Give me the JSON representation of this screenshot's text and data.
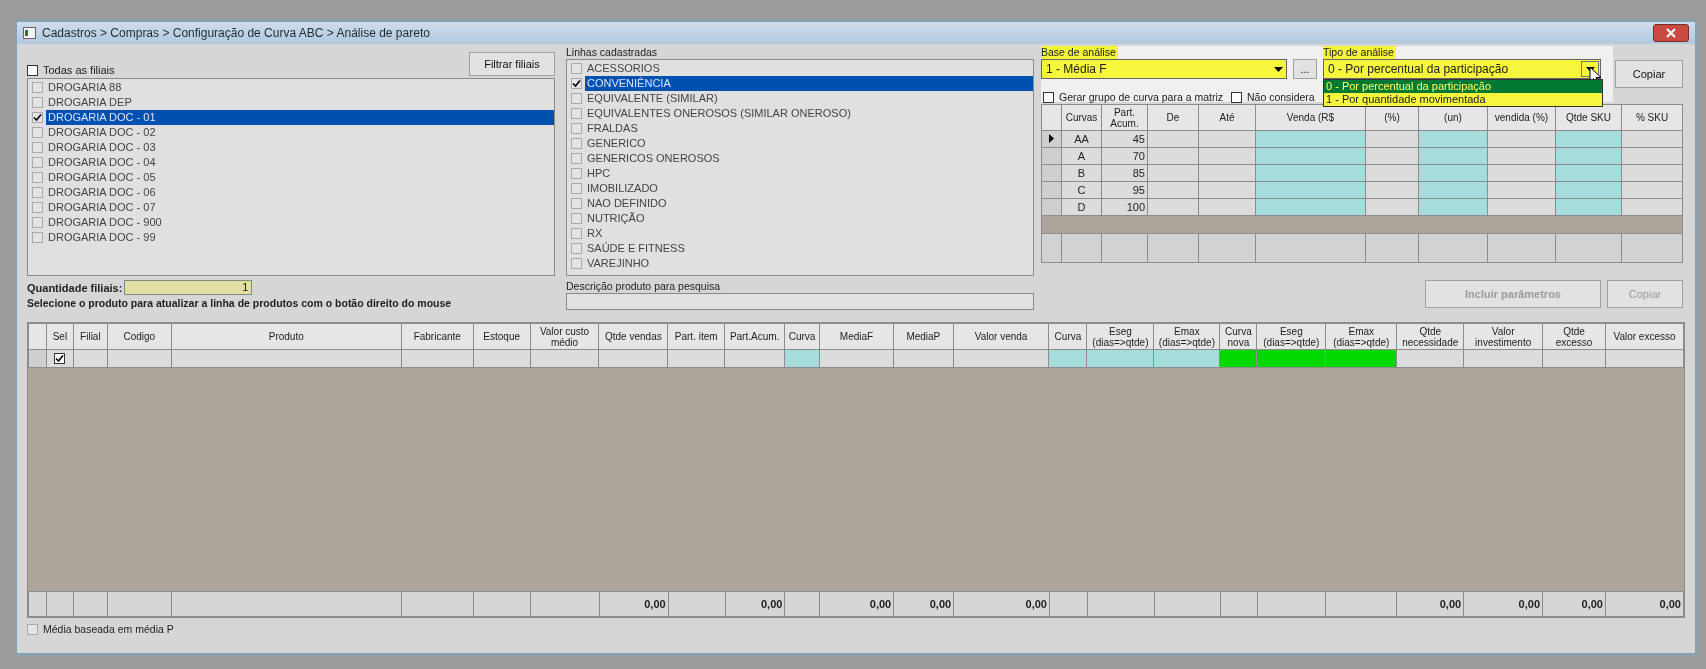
{
  "window": {
    "title": "Cadastros > Compras > Configuração de Curva ABC > Análise de pareto"
  },
  "branches": {
    "all_checkbox": {
      "label": "Todas as filiais",
      "checked": false
    },
    "filter_button": "Filtrar filiais",
    "items": [
      {
        "label": "DROGARIA 88",
        "checked": false,
        "selected": false
      },
      {
        "label": "DROGARIA DEP",
        "checked": false,
        "selected": false
      },
      {
        "label": "DROGARIA DOC - 01",
        "checked": true,
        "selected": true
      },
      {
        "label": "DROGARIA DOC - 02",
        "checked": false,
        "selected": false
      },
      {
        "label": "DROGARIA DOC - 03",
        "checked": false,
        "selected": false
      },
      {
        "label": "DROGARIA DOC - 04",
        "checked": false,
        "selected": false
      },
      {
        "label": "DROGARIA DOC - 05",
        "checked": false,
        "selected": false
      },
      {
        "label": "DROGARIA DOC - 06",
        "checked": false,
        "selected": false
      },
      {
        "label": "DROGARIA DOC - 07",
        "checked": false,
        "selected": false
      },
      {
        "label": "DROGARIA DOC - 900",
        "checked": false,
        "selected": false
      },
      {
        "label": "DROGARIA DOC - 99",
        "checked": false,
        "selected": false
      }
    ],
    "count_label": "Quantidade filiais:",
    "count_value": "1"
  },
  "instruction": "Selecione o produto para atualizar a linha de produtos com o botão direito do mouse",
  "lines": {
    "label": "Linhas cadastradas",
    "items": [
      {
        "label": "ACESSORIOS",
        "checked": false,
        "selected": false
      },
      {
        "label": "CONVENIÊNCIA",
        "checked": true,
        "selected": true
      },
      {
        "label": "EQUIVALENTE (SIMILAR)",
        "checked": false,
        "selected": false
      },
      {
        "label": "EQUIVALENTES ONEROSOS (SIMILAR ONEROSO)",
        "checked": false,
        "selected": false
      },
      {
        "label": "FRALDAS",
        "checked": false,
        "selected": false
      },
      {
        "label": "GENERICO",
        "checked": false,
        "selected": false
      },
      {
        "label": "GENERICOS ONEROSOS",
        "checked": false,
        "selected": false
      },
      {
        "label": "HPC",
        "checked": false,
        "selected": false
      },
      {
        "label": "IMOBILIZADO",
        "checked": false,
        "selected": false
      },
      {
        "label": "NAO DEFINIDO",
        "checked": false,
        "selected": false
      },
      {
        "label": "NUTRIÇÃO",
        "checked": false,
        "selected": false
      },
      {
        "label": "RX",
        "checked": false,
        "selected": false
      },
      {
        "label": "SAÚDE E FITNESS",
        "checked": false,
        "selected": false
      },
      {
        "label": "VAREJINHO",
        "checked": false,
        "selected": false
      }
    ]
  },
  "search": {
    "label": "Descrição produto para pesquisa"
  },
  "analysis_base": {
    "label": "Base de análise",
    "value": "1 - Média F",
    "more_button": "..."
  },
  "analysis_type": {
    "label": "Tipo de análise",
    "value": "0 - Por percentual da participação",
    "expanded": true,
    "options": [
      {
        "label": "0 - Por percentual da participação",
        "selected": true
      },
      {
        "label": "1 - Por quantidade movimentada",
        "selected": false
      }
    ]
  },
  "copy_button": {
    "label": "Copiar",
    "disabled": false
  },
  "options": [
    {
      "label": "Gerar grupo de curva para a matriz",
      "checked": false
    },
    {
      "label": "Não considera",
      "checked": false
    }
  ],
  "curve_grid": {
    "columns": [
      {
        "label": "Curvas"
      },
      {
        "label": "Part. Acum."
      },
      {
        "label": "De"
      },
      {
        "label": "Até"
      },
      {
        "label": "Venda (R$",
        "color": "#a6dcdc"
      },
      {
        "label": "(%)"
      },
      {
        "label": "(un)",
        "color": "#a6dcdc"
      },
      {
        "label": "vendida (%)"
      },
      {
        "label": "Qtde SKU",
        "color": "#a6dcdc"
      },
      {
        "label": "% SKU"
      }
    ],
    "rows": [
      {
        "curve": "AA",
        "share": "45",
        "current": true
      },
      {
        "curve": "A",
        "share": "70",
        "current": false
      },
      {
        "curve": "B",
        "share": "85",
        "current": false
      },
      {
        "curve": "C",
        "share": "95",
        "current": false
      },
      {
        "curve": "D",
        "share": "100",
        "current": false
      }
    ]
  },
  "params_button": {
    "label": "Incluir parâmetros",
    "disabled": true
  },
  "copy_button_2": {
    "label": "Copiar",
    "disabled": true
  },
  "products": {
    "columns": [
      {
        "label": "Sel"
      },
      {
        "label": "Filial"
      },
      {
        "label": "Codigo"
      },
      {
        "label": "Produto"
      },
      {
        "label": "Fabricante"
      },
      {
        "label": "Estoque"
      },
      {
        "label": "Valor custo médio"
      },
      {
        "label": "Qtde vendas",
        "total": "0,00"
      },
      {
        "label": "Part. item"
      },
      {
        "label": "Part.Acum.",
        "total": "0,00"
      },
      {
        "label": "Curva",
        "color": "#a6dcdc"
      },
      {
        "label": "MediaF",
        "total": "0,00"
      },
      {
        "label": "MediaP",
        "total": "0,00"
      },
      {
        "label": "Valor venda",
        "total": "0,00"
      },
      {
        "label": "Curva",
        "color": "#a6dcdc"
      },
      {
        "label": "Eseg (dias=>qtde)",
        "color": "#a6dcdc"
      },
      {
        "label": "Emax (dias=>qtde)",
        "color": "#a6dcdc"
      },
      {
        "label": "Curva nova",
        "color": "#00d800"
      },
      {
        "label": "Eseg (dias=>qtde)",
        "color": "#00d800"
      },
      {
        "label": "Emax (dias=>qtde)",
        "color": "#00d800"
      },
      {
        "label": "Qtde necessidade",
        "total": "0,00"
      },
      {
        "label": "Valor investimento",
        "total": "0,00"
      },
      {
        "label": "Qtde excesso",
        "total": "0,00"
      },
      {
        "label": "Valor excesso",
        "total": "0,00"
      }
    ],
    "rows": [
      {
        "sel": true
      }
    ]
  },
  "footer_checkbox": {
    "label": "Média baseada em média P",
    "checked": false
  }
}
